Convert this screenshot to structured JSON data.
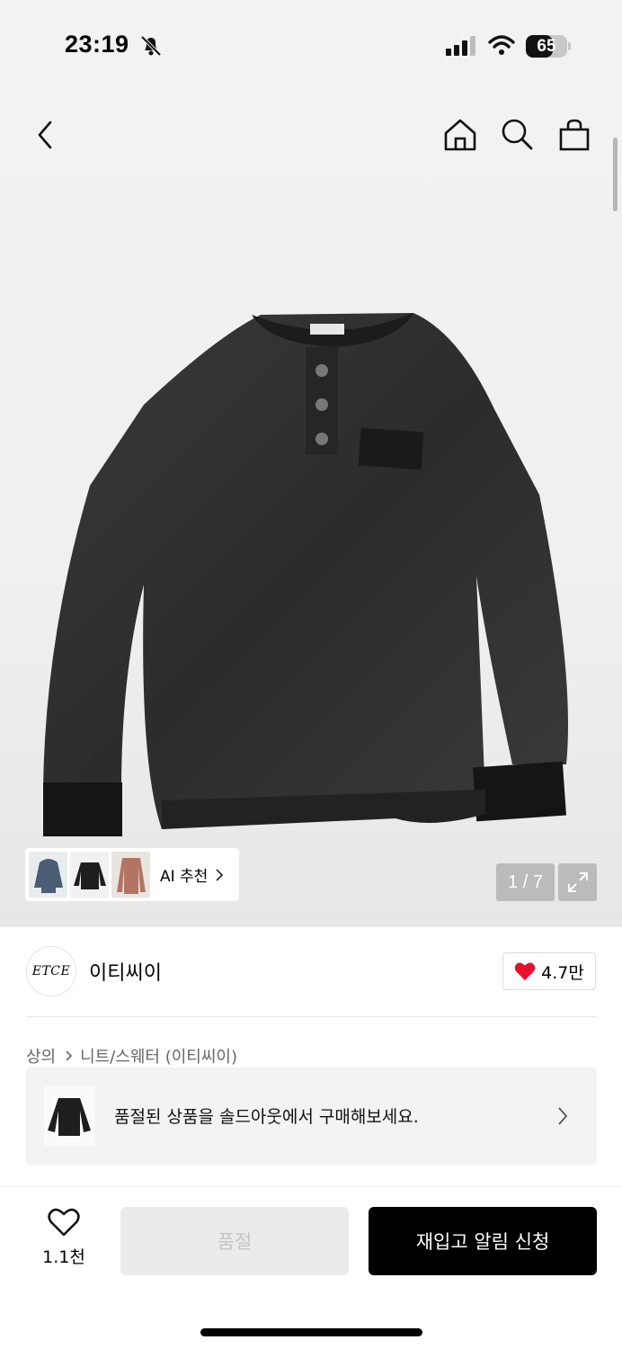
{
  "status_bar": {
    "time": "23:19",
    "battery_level": "65",
    "battery_percent": 65
  },
  "icons": {
    "back": "chevron-left-icon",
    "home": "home-icon",
    "search": "search-icon",
    "cart": "shopping-bag-icon",
    "expand": "expand-icon",
    "heart_filled": "heart-filled-icon",
    "heart_outline": "heart-outline-icon"
  },
  "gallery": {
    "counter": "1 / 7",
    "ai_recommend_label": "AI 추천"
  },
  "brand": {
    "logo_text": "ETCE",
    "name": "이티씨이",
    "likes": "4.7만"
  },
  "breadcrumb": {
    "category": "상의",
    "subcategory": "니트/스웨터 (이티씨이)"
  },
  "soldout_banner": {
    "text": "품절된 상품을 솔드아웃에서 구매해보세요."
  },
  "bottom_bar": {
    "wish_count": "1.1천",
    "soldout_label": "품절",
    "restock_label": "재입고 알림 신청"
  },
  "colors": {
    "accent_heart": "#e8112d",
    "primary_button": "#000000",
    "disabled_button": "#ebebeb"
  }
}
